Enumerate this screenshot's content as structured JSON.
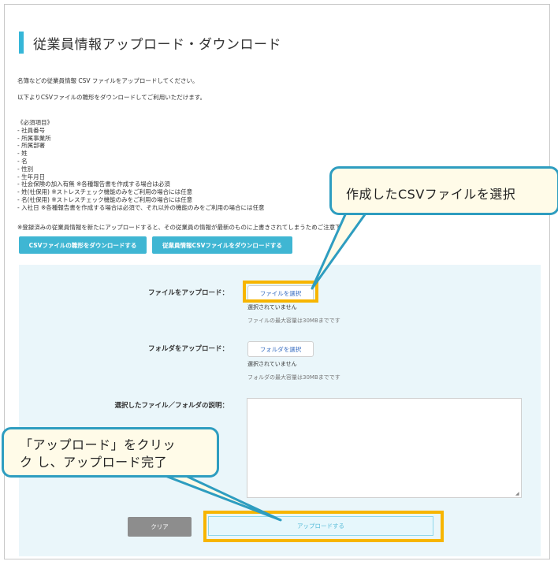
{
  "page": {
    "title": "従業員情報アップロード・ダウンロード",
    "intro_line1": "名簿などの従業員情報 CSV ファイルをアップロードしてください。",
    "intro_line2": "以下よりCSVファイルの雛形をダウンロードしてご利用いただけます。",
    "required_items": [
      "《必須項目》",
      "- 社員番号",
      "- 所属事業所",
      "- 所属部署",
      "- 姓",
      "- 名",
      "- 性別",
      "- 生年月日",
      "- 社会保険の加入有無 ※各種報告書を作成する場合は必須",
      "- 姓(社保用) ※ストレスチェック機能のみをご利用の場合には任意",
      "- 名(社保用) ※ストレスチェック機能のみをご利用の場合には任意",
      "- 入社日 ※各種報告書を作成する場合は必須で、それ以外の機能のみをご利用の場合には任意"
    ],
    "overwrite_note": "※登録済みの従業員情報を新たにアップロードすると、その従業員の情報が最新のものに上書きされてしまうためご注意下さい。",
    "download_template_button": "CSVファイルの雛形をダウンロードする",
    "download_employee_button": "従業員情報CSVファイルをダウンロードする"
  },
  "form": {
    "file_label": "ファイルをアップロード：",
    "file_button": "ファイルを選択",
    "file_status": "選択されていません",
    "file_limit": "ファイルの最大容量は30MBまでです",
    "folder_label": "フォルダをアップロード：",
    "folder_button": "フォルダを選択",
    "folder_status": "選択されていません",
    "folder_limit": "フォルダの最大容量は30MBまでです",
    "description_label": "選択したファイル／フォルダの説明：",
    "description_value": "",
    "clear_button": "クリア",
    "upload_button": "アップロードする"
  },
  "annotations": {
    "callout_select": "作成したCSVファイルを選択",
    "callout_upload_line1": "「アップロード」をクリッ",
    "callout_upload_line2": "ク し、アップロード完了",
    "highlight_color": "#f7b500",
    "callout_border_color": "#2e9dc0"
  },
  "colors": {
    "accent": "#35b6d8",
    "download_button": "#3fb6d3",
    "panel_bg": "#eaf6fa",
    "clear_button": "#8d8d8d"
  }
}
